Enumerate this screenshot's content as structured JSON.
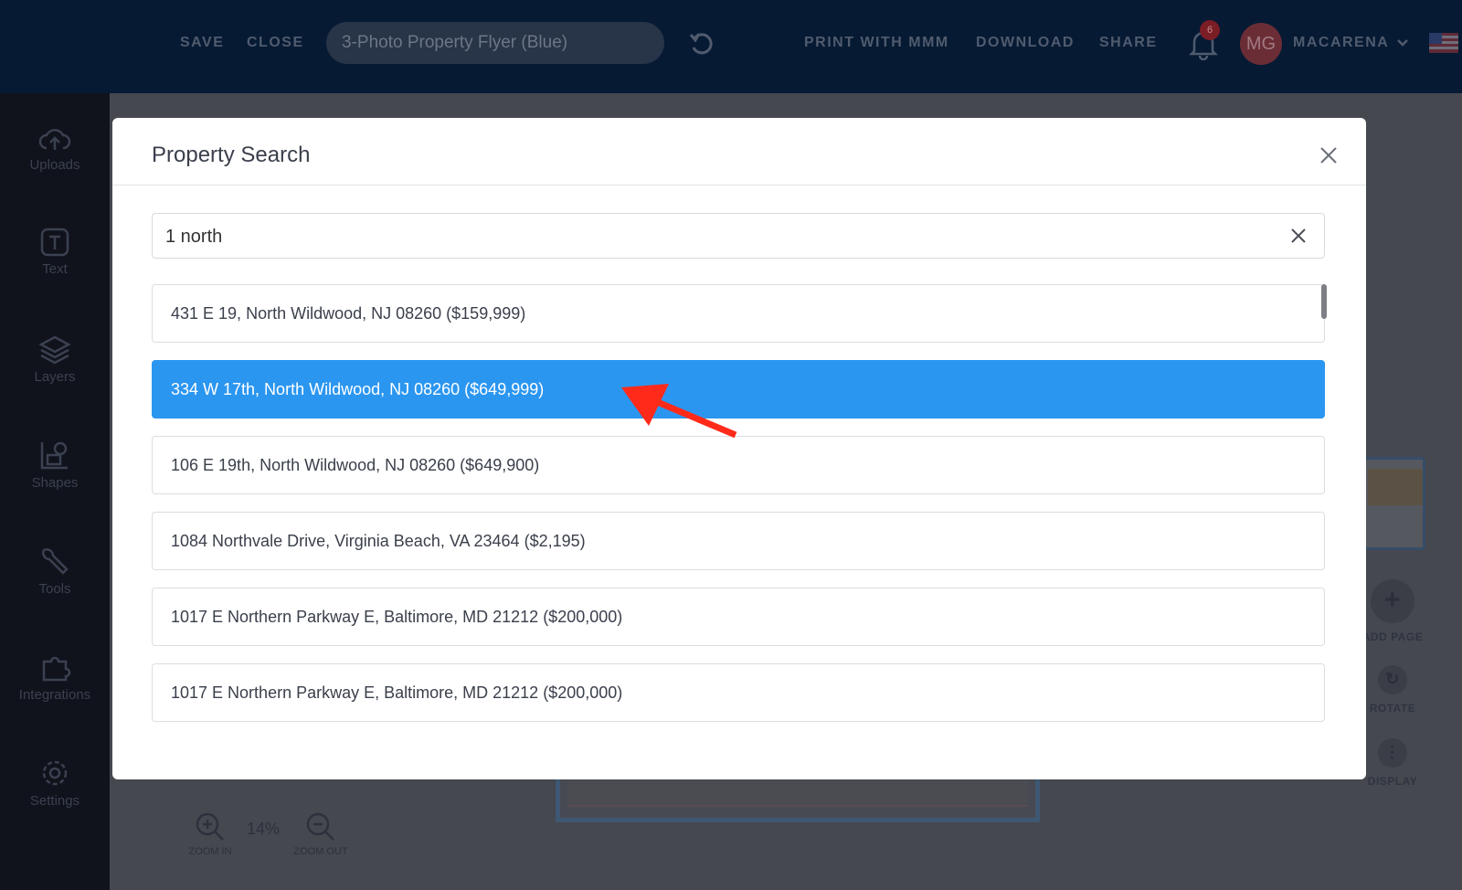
{
  "topbar": {
    "save": "SAVE",
    "close": "CLOSE",
    "doc_title": "3-Photo Property Flyer (Blue)",
    "print": "PRINT WITH MMM",
    "download": "DOWNLOAD",
    "share": "SHARE",
    "notification_count": "6",
    "avatar_initials": "MG",
    "user_name": "MACARENA"
  },
  "sidebar": {
    "uploads": "Uploads",
    "text": "Text",
    "layers": "Layers",
    "shapes": "Shapes",
    "tools": "Tools",
    "integrations": "Integrations",
    "settings": "Settings"
  },
  "canvas": {
    "zoom_in": "ZOOM IN",
    "zoom_value": "14%",
    "zoom_out": "ZOOM OUT",
    "add_page": "ADD PAGE",
    "rotate": "ROTATE",
    "display": "DISPLAY"
  },
  "modal": {
    "title": "Property Search",
    "search_value": "1 north",
    "results": [
      "431 E 19, North Wildwood, NJ 08260 ($159,999)",
      "334 W 17th, North Wildwood, NJ 08260 ($649,999)",
      "106 E 19th, North Wildwood, NJ 08260 ($649,900)",
      "1084 Northvale Drive, Virginia Beach, VA 23464 ($2,195)",
      "1017 E Northern Parkway E, Baltimore, MD 21212 ($200,000)",
      "1017 E Northern Parkway E, Baltimore, MD 21212 ($200,000)"
    ],
    "selected_index": 1
  },
  "colors": {
    "topbar": "#061a33",
    "selected": "#2b96f0",
    "annotation_arrow": "#ff2a1a"
  },
  "icons": [
    "undo-icon",
    "bell-icon",
    "chevron-down-icon",
    "flag-icon",
    "close-icon",
    "upload-icon",
    "text-icon",
    "layers-icon",
    "shapes-icon",
    "tools-icon",
    "integrations-icon",
    "settings-icon",
    "zoom-in-icon",
    "zoom-out-icon"
  ]
}
